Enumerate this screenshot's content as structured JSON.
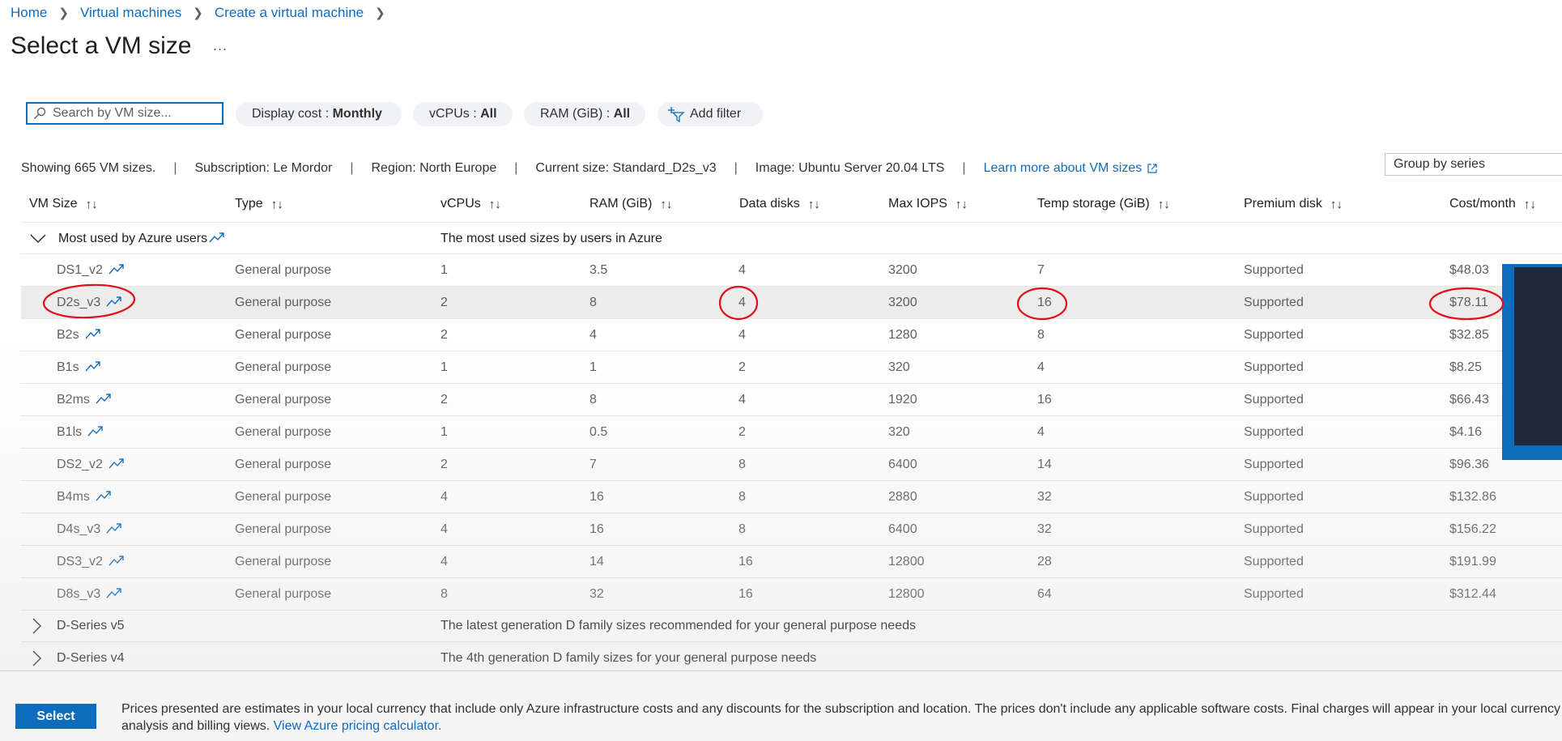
{
  "breadcrumb": [
    "Home",
    "Virtual machines",
    "Create a virtual machine"
  ],
  "page_title": "Select a VM size",
  "more_label": "...",
  "search": {
    "placeholder": "Search by VM size..."
  },
  "filters": [
    {
      "label": "Display cost : ",
      "value": "Monthly"
    },
    {
      "label": "vCPUs : ",
      "value": "All"
    },
    {
      "label": "RAM (GiB) : ",
      "value": "All"
    }
  ],
  "add_filter_label": "Add filter",
  "info": {
    "showing": "Showing 665 VM sizes.",
    "subscription": "Subscription: Le Mordor",
    "region": "Region: North Europe",
    "current_size": "Current size: Standard_D2s_v3",
    "image": "Image: Ubuntu Server 20.04 LTS",
    "learn_more": "Learn more about VM sizes"
  },
  "group_by": "Group by series",
  "columns": [
    "VM Size",
    "Type",
    "vCPUs",
    "RAM (GiB)",
    "Data disks",
    "Max IOPS",
    "Temp storage (GiB)",
    "Premium disk",
    "Cost/month"
  ],
  "groups": [
    {
      "name": "Most used by Azure users",
      "description": "The most used sizes by users in Azure",
      "expanded": true
    },
    {
      "name": "D-Series v5",
      "description": "The latest generation D family sizes recommended for your general purpose needs",
      "expanded": false
    },
    {
      "name": "D-Series v4",
      "description": "The 4th generation D family sizes for your general purpose needs",
      "expanded": false
    }
  ],
  "rows": [
    {
      "size": "DS1_v2",
      "type": "General purpose",
      "vcpus": "1",
      "ram": "3.5",
      "disks": "4",
      "iops": "3200",
      "temp": "7",
      "premium": "Supported",
      "cost": "$48.03"
    },
    {
      "size": "D2s_v3",
      "type": "General purpose",
      "vcpus": "2",
      "ram": "8",
      "disks": "4",
      "iops": "3200",
      "temp": "16",
      "premium": "Supported",
      "cost": "$78.11"
    },
    {
      "size": "B2s",
      "type": "General purpose",
      "vcpus": "2",
      "ram": "4",
      "disks": "4",
      "iops": "1280",
      "temp": "8",
      "premium": "Supported",
      "cost": "$32.85"
    },
    {
      "size": "B1s",
      "type": "General purpose",
      "vcpus": "1",
      "ram": "1",
      "disks": "2",
      "iops": "320",
      "temp": "4",
      "premium": "Supported",
      "cost": "$8.25"
    },
    {
      "size": "B2ms",
      "type": "General purpose",
      "vcpus": "2",
      "ram": "8",
      "disks": "4",
      "iops": "1920",
      "temp": "16",
      "premium": "Supported",
      "cost": "$66.43"
    },
    {
      "size": "B1ls",
      "type": "General purpose",
      "vcpus": "1",
      "ram": "0.5",
      "disks": "2",
      "iops": "320",
      "temp": "4",
      "premium": "Supported",
      "cost": "$4.16"
    },
    {
      "size": "DS2_v2",
      "type": "General purpose",
      "vcpus": "2",
      "ram": "7",
      "disks": "8",
      "iops": "6400",
      "temp": "14",
      "premium": "Supported",
      "cost": "$96.36"
    },
    {
      "size": "B4ms",
      "type": "General purpose",
      "vcpus": "4",
      "ram": "16",
      "disks": "8",
      "iops": "2880",
      "temp": "32",
      "premium": "Supported",
      "cost": "$132.86"
    },
    {
      "size": "D4s_v3",
      "type": "General purpose",
      "vcpus": "4",
      "ram": "16",
      "disks": "8",
      "iops": "6400",
      "temp": "32",
      "premium": "Supported",
      "cost": "$156.22"
    },
    {
      "size": "DS3_v2",
      "type": "General purpose",
      "vcpus": "4",
      "ram": "14",
      "disks": "16",
      "iops": "12800",
      "temp": "28",
      "premium": "Supported",
      "cost": "$191.99"
    },
    {
      "size": "D8s_v3",
      "type": "General purpose",
      "vcpus": "8",
      "ram": "32",
      "disks": "16",
      "iops": "12800",
      "temp": "64",
      "premium": "Supported",
      "cost": "$312.44"
    }
  ],
  "footer": {
    "select_label": "Select",
    "disclaimer_line1": "Prices presented are estimates in your local currency that include only Azure infrastructure costs and any discounts for the subscription and location. The prices don't include any applicable software costs. Final charges will appear in your local currency in cost",
    "disclaimer_line2": "analysis and billing views.",
    "pricing_link": "View Azure pricing calculator."
  },
  "colors": {
    "accent": "#0f6cbd",
    "annotation": "#e0101a"
  }
}
